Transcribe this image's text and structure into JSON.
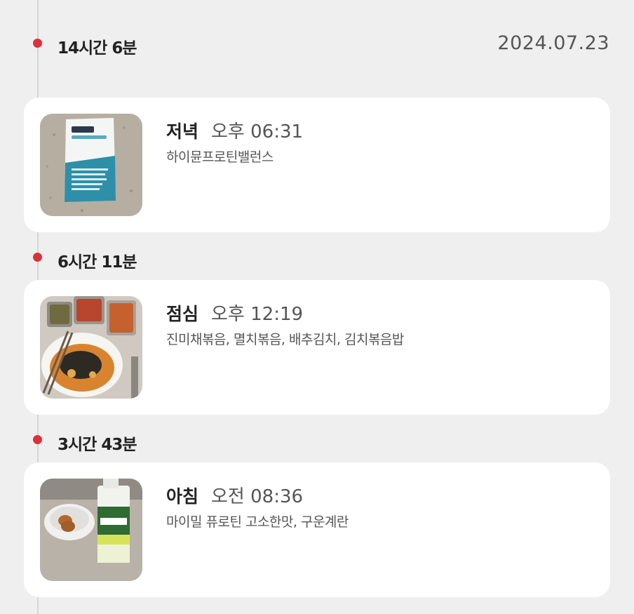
{
  "date": "2024.07.23",
  "colors": {
    "background": "#efefef",
    "card": "#ffffff",
    "dot": "#d9323a",
    "line": "#d6d6d6"
  },
  "entries": [
    {
      "gap": "14시간 6분",
      "meal_type": "저녁",
      "time": "오후 06:31",
      "foods": "하이뮨프로틴밸런스",
      "thumbnail_icon": "protein-powder-pouch"
    },
    {
      "gap": "6시간 11분",
      "meal_type": "점심",
      "time": "오후 12:19",
      "foods": "진미채볶음, 멸치볶음, 배추김치, 김치볶음밥",
      "thumbnail_icon": "kimchi-fried-rice-meal"
    },
    {
      "gap": "3시간 43분",
      "meal_type": "아침",
      "time": "오전 08:36",
      "foods": "마이밀 퓨로틴 고소한맛, 구운계란",
      "thumbnail_icon": "protein-drink-and-eggs"
    }
  ]
}
